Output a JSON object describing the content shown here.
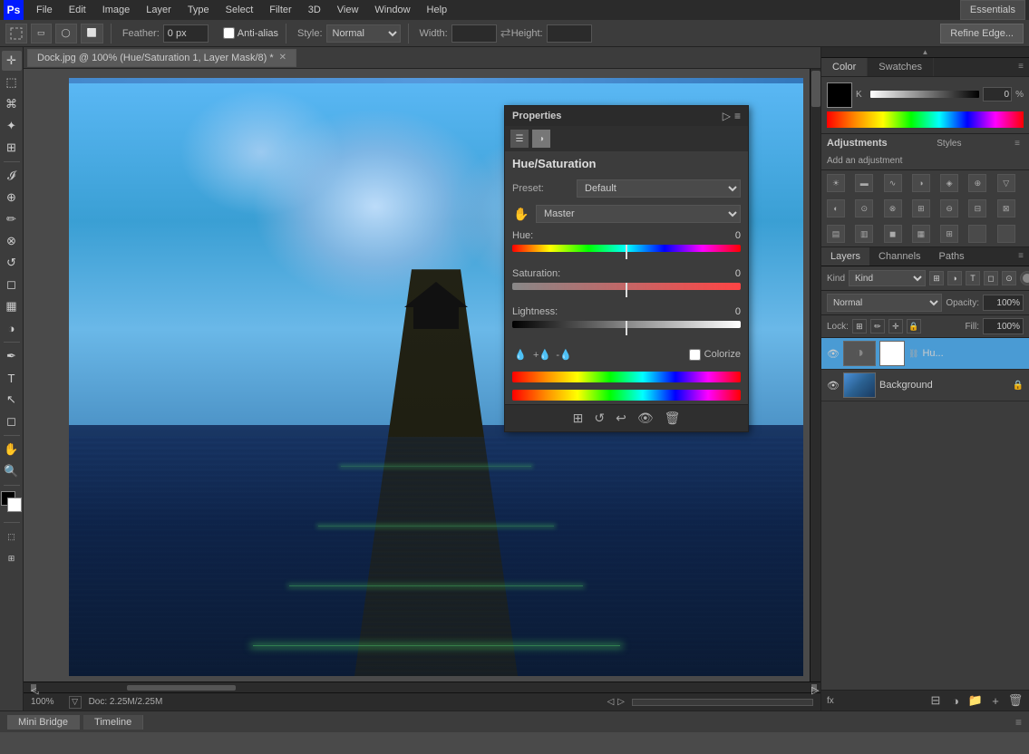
{
  "app": {
    "title": "Adobe Photoshop",
    "logo": "Ps",
    "workspace": "Essentials"
  },
  "menu": {
    "items": [
      "PS",
      "File",
      "Edit",
      "Image",
      "Layer",
      "Type",
      "Select",
      "Filter",
      "3D",
      "View",
      "Window",
      "Help"
    ]
  },
  "toolbar": {
    "feather_label": "Feather:",
    "feather_value": "0 px",
    "anti_alias_label": "Anti-alias",
    "style_label": "Style:",
    "style_value": "Normal",
    "width_label": "Width:",
    "height_label": "Height:",
    "refine_edge": "Refine Edge...",
    "essentials": "Essentials"
  },
  "tab": {
    "filename": "Dock.jpg @ 100% (Hue/Saturation 1, Layer Mask/8) *"
  },
  "properties": {
    "title": "Properties",
    "adjustment_name": "Hue/Saturation",
    "preset_label": "Preset:",
    "preset_value": "Default",
    "channel_label": "Master",
    "hue_label": "Hue:",
    "hue_value": "0",
    "saturation_label": "Saturation:",
    "saturation_value": "0",
    "lightness_label": "Lightness:",
    "lightness_value": "0",
    "colorize_label": "Colorize"
  },
  "color_panel": {
    "tab_color": "Color",
    "tab_swatches": "Swatches",
    "k_label": "K",
    "k_value": "0",
    "percent": "%"
  },
  "adjustments": {
    "title": "Adjustments",
    "styles_label": "Styles",
    "add_adjustment": "Add an adjustment"
  },
  "layers": {
    "title": "Layers",
    "channels_tab": "Channels",
    "paths_tab": "Paths",
    "kind_label": "Kind",
    "blend_mode": "Normal",
    "opacity_label": "Opacity:",
    "opacity_value": "100%",
    "lock_label": "Lock:",
    "fill_label": "Fill:",
    "fill_value": "100%",
    "layers": [
      {
        "name": "Hu...",
        "type": "adjustment",
        "visible": true,
        "has_mask": true
      },
      {
        "name": "Background",
        "type": "image",
        "visible": true,
        "locked": true
      }
    ]
  },
  "status": {
    "zoom": "100%",
    "doc_info": "Doc: 2.25M/2.25M"
  },
  "bottom_tabs": [
    {
      "label": "Mini Bridge",
      "active": true
    },
    {
      "label": "Timeline",
      "active": false
    }
  ]
}
